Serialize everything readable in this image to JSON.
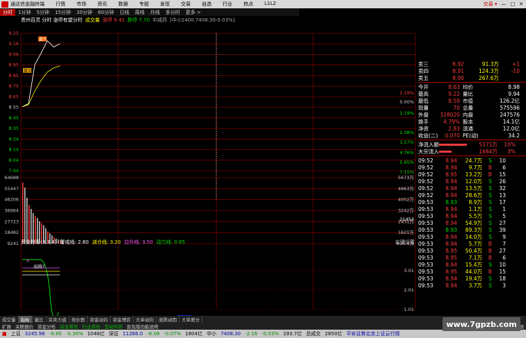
{
  "app": {
    "title": "通达信金融终端",
    "menu": [
      "行情",
      "市场",
      "资讯",
      "数据",
      "专题",
      "发现",
      "交易",
      "自选",
      "行业",
      "热点",
      "L1L2"
    ],
    "trade_label": "交易 ▾",
    "window_buttons": [
      "—",
      "□",
      "✕"
    ]
  },
  "period_tabs": [
    "分时",
    "1分钟",
    "5分钟",
    "15分钟",
    "30分钟",
    "60分钟",
    "日线",
    "周线",
    "月线",
    "多分时",
    "更多 >"
  ],
  "info_line": {
    "name": "贵州百灵 分时 涨停有望分时",
    "vol": "成交量",
    "up": "涨停 9.41",
    "down": "跌停 7.70",
    "middle": "中成药",
    "extra": "[中小1400.7408.30-0.03%]"
  },
  "price_axis": [
    "9.25",
    "9.16",
    "9.06",
    "8.95",
    "8.85",
    "8.75",
    "8.65",
    "8.55",
    "8.45",
    "8.35",
    "8.24",
    "8.14",
    "8.04",
    "7.94"
  ],
  "pct_axis": [
    "1.19%",
    "0.00%",
    "1.19%",
    "2.38%",
    "3.57%",
    "4.76%",
    "5.95%",
    "7.15%"
  ],
  "volume_axis_left": [
    "64688",
    "55447",
    "46206",
    "36964",
    "27723",
    "18482",
    "9241"
  ],
  "volume_axis_right": [
    "5673万",
    "4863万",
    "4052万",
    "3242万",
    "2431万",
    "1621万",
    "810.4万"
  ],
  "volume_tag": "21453",
  "indicator": {
    "title": "资金抢筹(3,3,4)",
    "v1": "警戒线: 2.80",
    "v2": "减仓线: 3.20",
    "v3": "拉升线: 3.50",
    "v4": "动力线: 0.65",
    "button": "右键设置",
    "axis": [
      "3.01",
      "2.01",
      "1.01"
    ],
    "note": "出局?"
  },
  "time_axis": [
    "09:30",
    "10:30",
    "11:13",
    "13:00",
    "14:00",
    "15:00"
  ],
  "annotations": [
    "卖7",
    "买3"
  ],
  "chart_data": {
    "type": "line",
    "x": [
      "09:30",
      "09:35",
      "09:40",
      "09:45",
      "09:50",
      "09:55",
      "10:00"
    ],
    "y": [
      8.55,
      8.58,
      8.95,
      9.06,
      9.18,
      9.12,
      9.15
    ],
    "avg": [
      8.55,
      8.57,
      8.7,
      8.8,
      8.88,
      8.92,
      8.94
    ],
    "ylim": [
      7.94,
      9.25
    ],
    "prev_close": 8.55
  },
  "quote": {
    "asks": [
      [
        "卖三",
        "8.92",
        "91.3万"
      ],
      [
        "卖四",
        "8.91",
        "124.3万"
      ],
      [
        "卖五",
        "8.90",
        "267.6万"
      ]
    ],
    "ask_extra": [
      "+1",
      "-10"
    ],
    "stats": [
      [
        [
          "今开",
          "8.63"
        ],
        [
          "均价",
          "8.98"
        ]
      ],
      [
        [
          "最高",
          "9.22"
        ],
        [
          "量比",
          "9.94"
        ]
      ],
      [
        [
          "最低",
          "8.59"
        ],
        [
          "市值",
          "126.2亿"
        ]
      ],
      [
        [
          "现量",
          "70"
        ],
        [
          "总量",
          "575596"
        ]
      ],
      [
        [
          "外盘",
          "328020"
        ],
        [
          "内盘",
          "247576"
        ]
      ],
      [
        [
          "换手",
          "4.79%"
        ],
        [
          "股本",
          "14.1亿"
        ]
      ],
      [
        [
          "净资",
          "2.83"
        ],
        [
          "流通",
          "12.0亿"
        ]
      ],
      [
        [
          "收益(二)",
          "0.070"
        ],
        [
          "PE(动)",
          "34.2"
        ]
      ]
    ],
    "flows": [
      [
        "净流入额",
        "5371万",
        "10%"
      ],
      [
        "大宗流入",
        "1684万",
        "3%"
      ]
    ]
  },
  "ticks": [
    [
      "09:52",
      "8.94",
      "24.7万",
      "S",
      "10"
    ],
    [
      "09:52",
      "8.94",
      "9.7万",
      "B",
      "6"
    ],
    [
      "09:52",
      "8.95",
      "13.2万",
      "B",
      "15"
    ],
    [
      "09:52",
      "8.94",
      "12.0万",
      "S",
      "26"
    ],
    [
      "09:52",
      "8.94",
      "13.5万",
      "S",
      "32"
    ],
    [
      "09:52",
      "8.94",
      "28.6万",
      "S",
      "13"
    ],
    [
      "09:53",
      "8.93",
      "8.9万",
      "S",
      "17"
    ],
    [
      "09:53",
      "8.94",
      "1.1万",
      "S",
      "1"
    ],
    [
      "09:53",
      "8.94",
      "5.5万",
      "S",
      "5"
    ],
    [
      "09:53",
      "8.94",
      "54.9万",
      "S",
      "27"
    ],
    [
      "09:53",
      "8.93",
      "89.3万",
      "S",
      "39"
    ],
    [
      "09:53",
      "8.94",
      "14.0万",
      "S",
      "9"
    ],
    [
      "09:53",
      "8.94",
      "5.7万",
      "B",
      "7"
    ],
    [
      "09:53",
      "8.95",
      "50.4万",
      "B",
      "27"
    ],
    [
      "09:53",
      "8.95",
      "7.1万",
      "B",
      "6"
    ],
    [
      "09:53",
      "8.94",
      "15.4万",
      "S",
      "10"
    ],
    [
      "09:53",
      "8.95",
      "44.0万",
      "B",
      "15"
    ],
    [
      "09:53",
      "8.94",
      "19.4万",
      "S",
      "18"
    ],
    [
      "09:53",
      "8.94",
      "3.7万",
      "S",
      "3"
    ]
  ],
  "bottom_tabs": [
    "成交量",
    "指标",
    "量比",
    "买卖力道",
    "竞价图",
    "资金动向",
    "资金博弈",
    "大单动向",
    "涨跌动因",
    "大单差分"
  ],
  "bottom_tabs2": [
    "扩展",
    "关联报价",
    "资金分布",
    "综合资讯",
    "行业资讯",
    "互动问答",
    "普及版功能说明"
  ],
  "bottom_right": "图文F10 数据",
  "status": {
    "sh_label": "上证",
    "sh_val": "3245.96",
    "sh_chg": "-9.85",
    "sh_pct": "-0.30%",
    "sh_amt": "1046亿",
    "sz_label": "深证",
    "sz_val": "11266.0",
    "sz_chg": "-8.08",
    "sz_pct": "-0.07%",
    "sz_amt": "1804亿",
    "zx_label": "中小",
    "zx_val": "7408.30",
    "zx_chg": "-2.16",
    "zx_pct": "-0.03%",
    "zx_amt": "193.7亿",
    "total_label": "总成交",
    "total_val": "2850亿",
    "broker": "平安证券北京上证云行情"
  },
  "watermark": "www.7gpzb.com",
  "colors": {
    "up": "#ff3c3c",
    "down": "#00e000",
    "grid": "#a00000",
    "bg": "#000000"
  }
}
